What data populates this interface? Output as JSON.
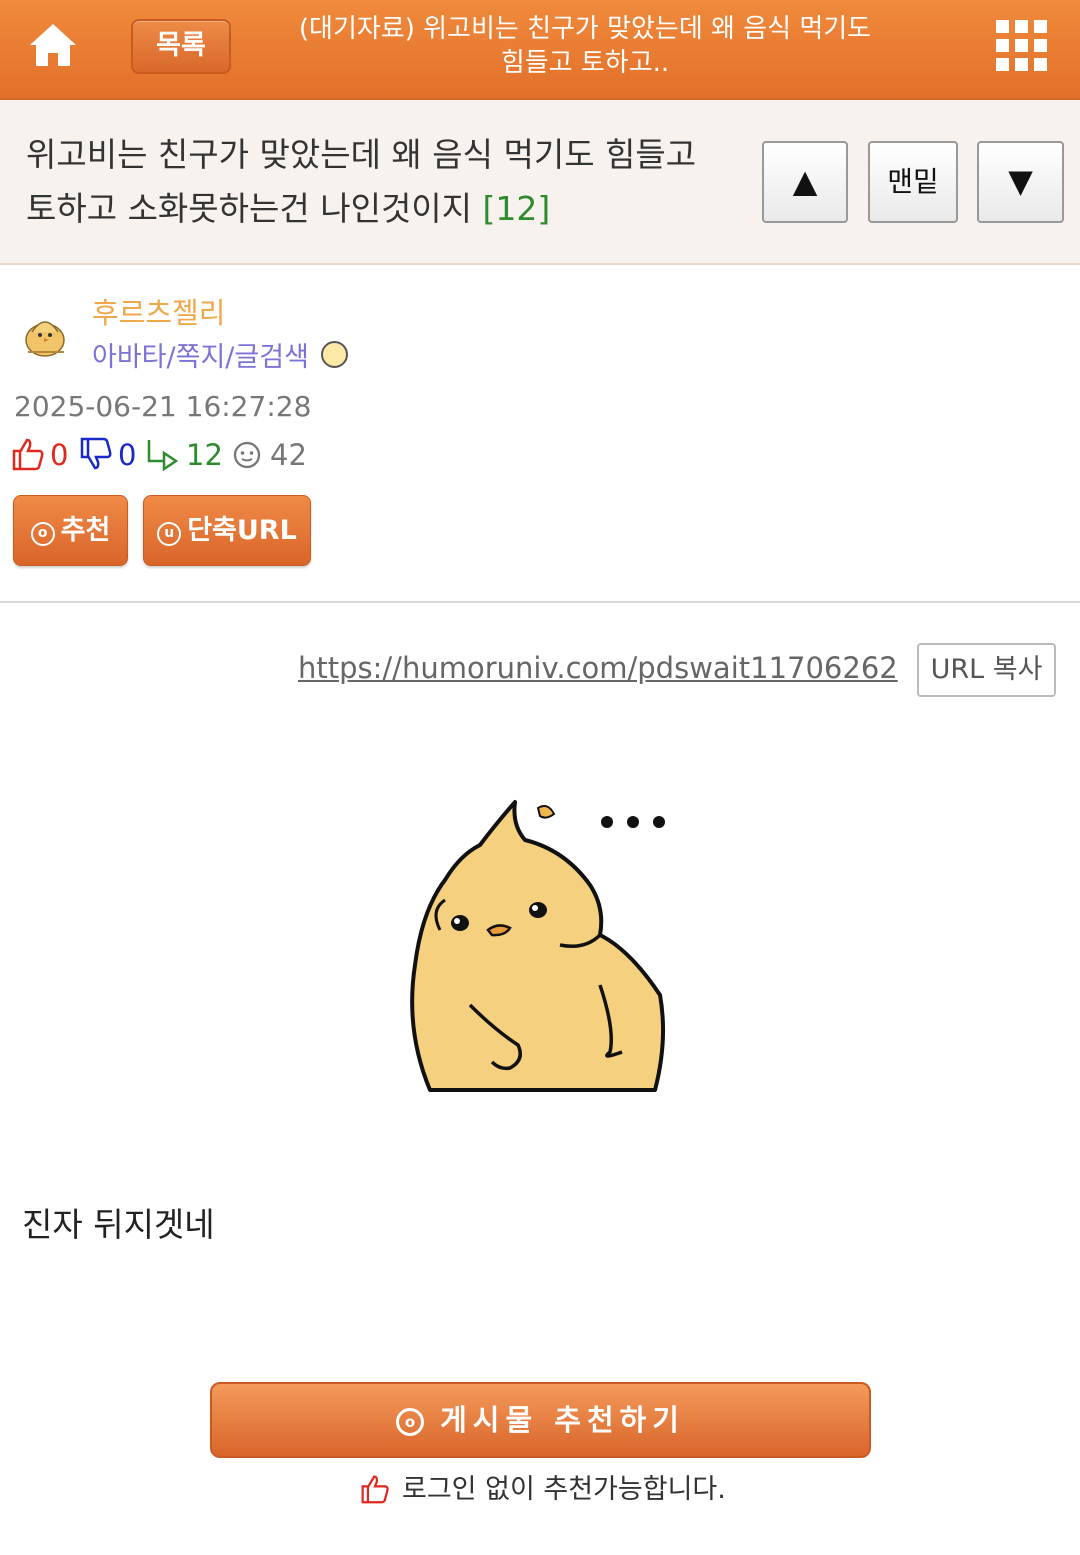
{
  "header": {
    "list_label": "목록",
    "title": "(대기자료) 위고비는 친구가 맞았는데 왜 음식 먹기도 힘들고 토하고..",
    "home_icon": "home-icon",
    "menu_icon": "grid-menu-icon",
    "color": "#e87a33"
  },
  "post": {
    "title": "위고비는 친구가 맞았는데 왜 음식 먹기도 힘들고 토하고 소화못하는건 나인것이지",
    "comment_count": "[12]",
    "nav_up": "▲",
    "nav_bottom": "맨밑",
    "nav_down": "▼"
  },
  "author": {
    "name": "후르츠젤리",
    "links": "아바타/쪽지/글검색"
  },
  "meta": {
    "date": "2025-06-21 16:27:28",
    "likes": "0",
    "dislikes": "0",
    "comments": "12",
    "views": "42"
  },
  "actions": {
    "recommend": "추천",
    "short_url": "단축URL"
  },
  "content": {
    "url": "https://humoruniv.com/pdswait11706262",
    "url_copy": "URL 복사",
    "text": "진자 뒤지겟네"
  },
  "footer": {
    "recommend_post": "게시물 추천하기",
    "login_note": "로그인 없이 추천가능합니다."
  }
}
